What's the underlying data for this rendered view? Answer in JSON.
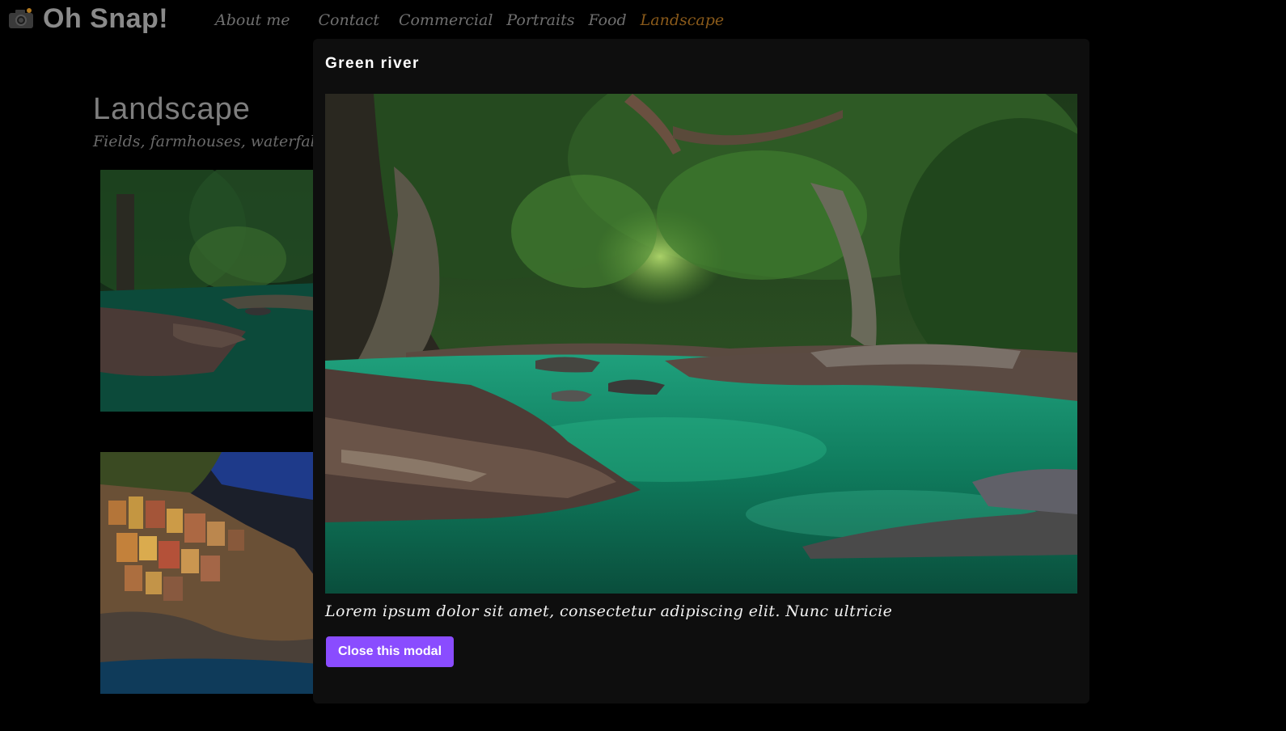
{
  "site": {
    "brand_name": "Oh Snap!",
    "logo_icon": "camera-icon"
  },
  "nav": {
    "items": [
      {
        "label": "About me",
        "active": false
      },
      {
        "label": "Contact",
        "active": false
      },
      {
        "label": "Commercial",
        "active": false
      },
      {
        "label": "Portraits",
        "active": false
      },
      {
        "label": "Food",
        "active": false
      },
      {
        "label": "Landscape",
        "active": true
      }
    ],
    "active_color": "#8a5a1a"
  },
  "section": {
    "title": "Landscape",
    "subtitle": "Fields, farmhouses, waterfalls,"
  },
  "gallery": {
    "thumbnails": [
      {
        "subject": "green-river-photo"
      },
      {
        "subject": "coastal-village-photo"
      }
    ]
  },
  "modal": {
    "title": "Green river",
    "image_subject": "green-river-photo",
    "caption": "Lorem ipsum dolor sit amet, consectetur adipiscing elit. Nunc ultricie",
    "close_label": "Close this modal",
    "close_color": "#8a4cff"
  }
}
